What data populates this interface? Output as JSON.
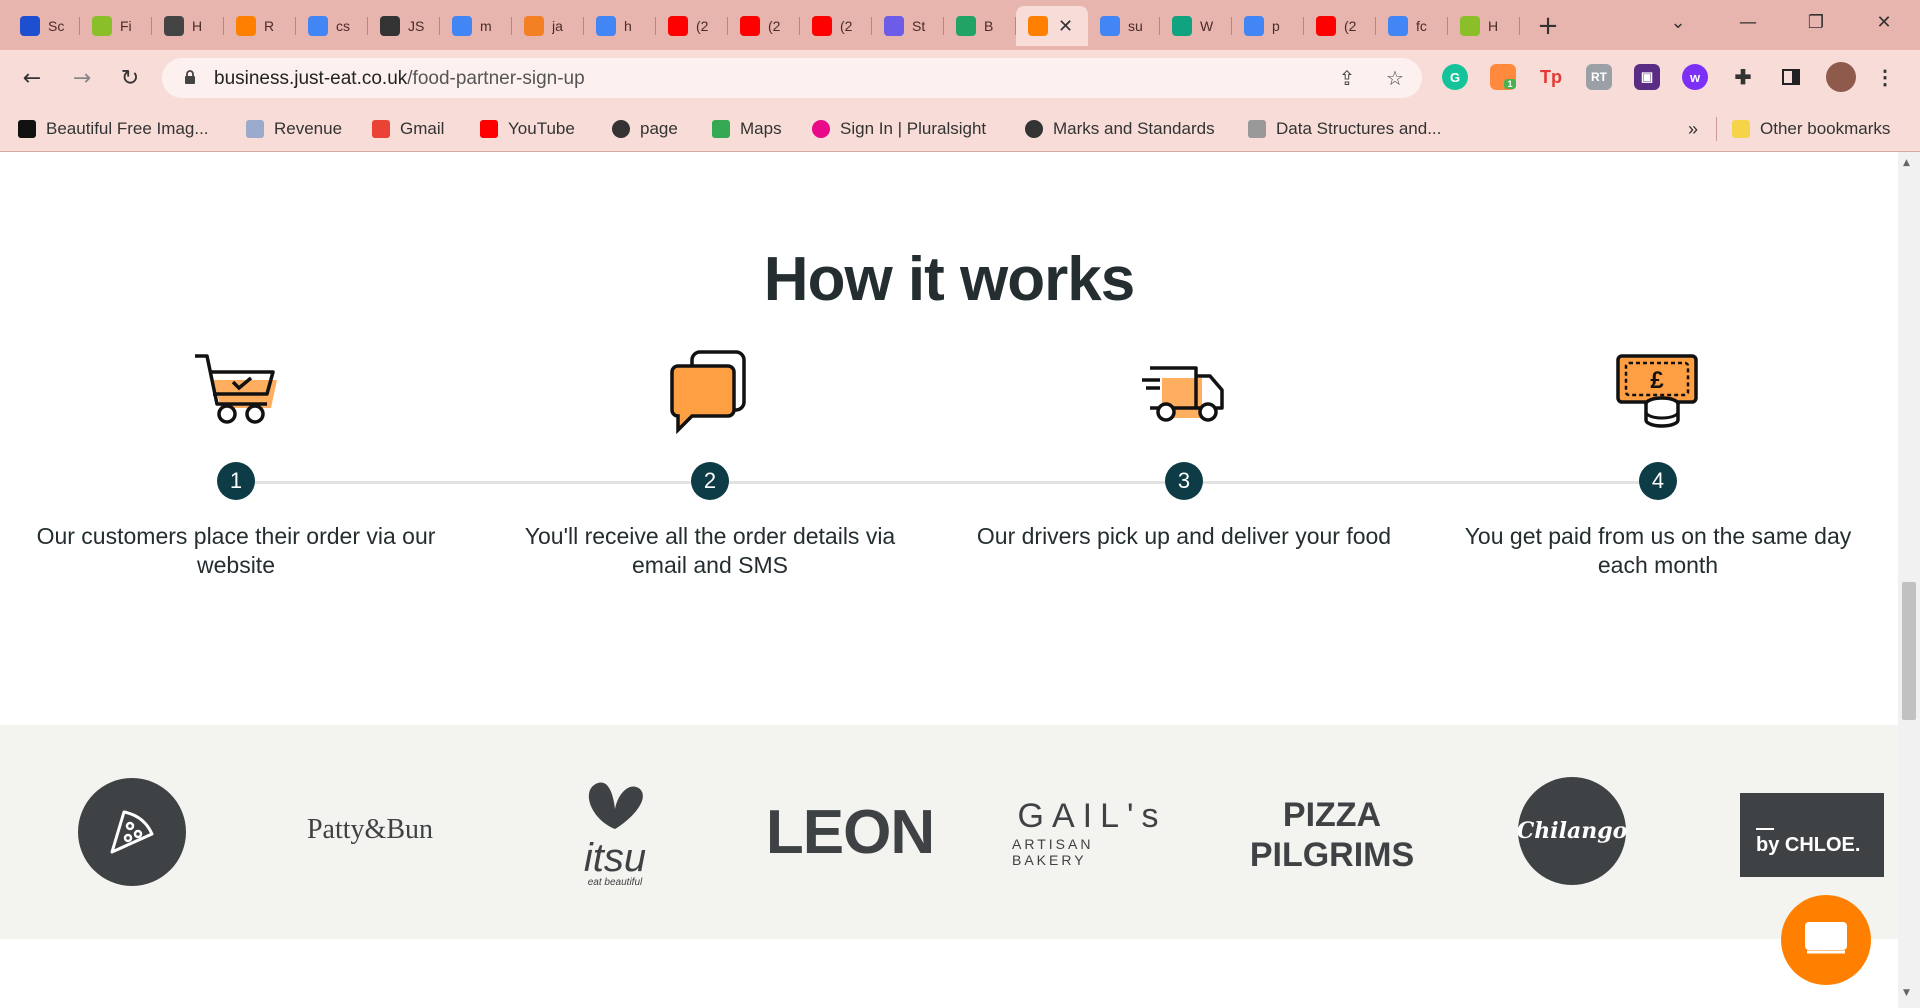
{
  "browser": {
    "tabs": [
      {
        "title": "Sc",
        "icon": "trello-icon",
        "color": "#1f4fd1"
      },
      {
        "title": "Fi",
        "icon": "virus-icon",
        "color": "#8bbf2a"
      },
      {
        "title": "H",
        "icon": "history-icon",
        "color": "#444444"
      },
      {
        "title": "R",
        "icon": "justeat-icon",
        "color": "#ff8000"
      },
      {
        "title": "cs",
        "icon": "google-icon",
        "color": "#4285f4"
      },
      {
        "title": "JS",
        "icon": "globe-icon",
        "color": "#333333"
      },
      {
        "title": "m",
        "icon": "google-icon",
        "color": "#4285f4"
      },
      {
        "title": "ja",
        "icon": "stackoverflow-icon",
        "color": "#f48024"
      },
      {
        "title": "h",
        "icon": "google-icon",
        "color": "#4285f4"
      },
      {
        "title": "(2",
        "icon": "youtube-icon",
        "color": "#ff0000"
      },
      {
        "title": "(2",
        "icon": "youtube-icon",
        "color": "#ff0000"
      },
      {
        "title": "(2",
        "icon": "youtube-icon",
        "color": "#ff0000"
      },
      {
        "title": "St",
        "icon": "s-purple-icon",
        "color": "#6c5ce7"
      },
      {
        "title": "B",
        "icon": "s-green-icon",
        "color": "#21a366"
      },
      {
        "title": "",
        "icon": "justeat-icon",
        "color": "#ff8000",
        "active": true
      },
      {
        "title": "su",
        "icon": "google-icon",
        "color": "#4285f4"
      },
      {
        "title": "W",
        "icon": "openai-icon",
        "color": "#10a37f"
      },
      {
        "title": "p",
        "icon": "google-icon",
        "color": "#4285f4"
      },
      {
        "title": "(2",
        "icon": "youtube-icon",
        "color": "#ff0000"
      },
      {
        "title": "fc",
        "icon": "google-icon",
        "color": "#4285f4"
      },
      {
        "title": "H",
        "icon": "virus-icon",
        "color": "#8bbf2a"
      }
    ],
    "url_host": "business.just-eat.co.uk",
    "url_path": "/food-partner-sign-up",
    "bookmarks": [
      {
        "label": "Beautiful Free Imag...",
        "icon": "unsplash-icon"
      },
      {
        "label": "Revenue",
        "icon": "revenue-icon"
      },
      {
        "label": "Gmail",
        "icon": "gmail-icon"
      },
      {
        "label": "YouTube",
        "icon": "youtube-icon"
      },
      {
        "label": "page",
        "icon": "globe-icon"
      },
      {
        "label": "Maps",
        "icon": "maps-icon"
      },
      {
        "label": "Sign In | Pluralsight",
        "icon": "pluralsight-icon"
      },
      {
        "label": "Marks and Standards",
        "icon": "globe-icon"
      },
      {
        "label": "Data Structures and...",
        "icon": "ds-icon"
      }
    ],
    "overflow_label": "»",
    "other_bookmarks": "Other bookmarks",
    "extensions": [
      "grammarly-icon",
      "extension-badge-icon",
      "tp-icon",
      "rt-icon",
      "purple-ext-icon",
      "w-ext-icon",
      "puzzle-icon",
      "sidepanel-icon",
      "profile-avatar",
      "menu-dots-icon"
    ],
    "extension_badge": "1",
    "extension_tp": "Tp",
    "extension_rt": "RT"
  },
  "section": {
    "title": "How it works",
    "steps": [
      {
        "number": "1",
        "text": "Our customers place their order via our website",
        "icon": "shopping-cart-icon"
      },
      {
        "number": "2",
        "text": "You'll receive all the order details via email and SMS",
        "icon": "chat-bubbles-icon"
      },
      {
        "number": "3",
        "text": "Our drivers pick up and deliver your food",
        "icon": "delivery-van-icon"
      },
      {
        "number": "4",
        "text": "You get paid from us on the same day each month",
        "icon": "money-coins-icon"
      }
    ]
  },
  "partners": {
    "pattybun": "Patty&Bun",
    "itsu": "itsu",
    "itsu_tag": "eat beautiful",
    "leon": "LEON",
    "gails": "GAIL's",
    "gails_sub": "ARTISAN BAKERY",
    "pizza_line1": "PIZZA",
    "pizza_line2": "PILGRIMS",
    "chilango": "Chilango",
    "bychloe": "by CHLOE."
  },
  "colors": {
    "accent": "#ff8000",
    "step_circle": "#0d3b46",
    "heading": "#242e30",
    "tabstrip": "#e8b4ae",
    "logo_band": "#f3f3ef"
  }
}
